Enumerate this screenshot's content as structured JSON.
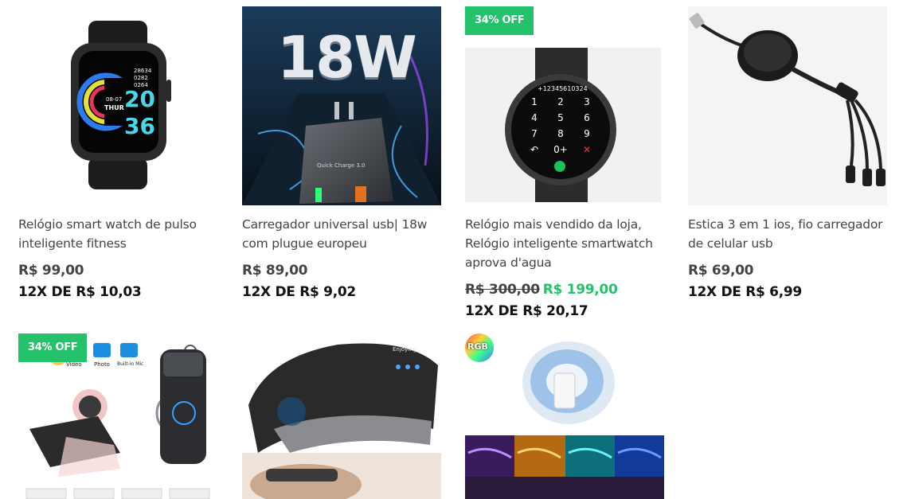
{
  "products": [
    {
      "name": "Relógio smart watch de pulso inteligente fitness",
      "price": "R$ 99,00",
      "installment": "12X DE R$ 10,03",
      "watch_screen": {
        "date": "08-07",
        "day": "THUR",
        "hour": "20",
        "minute": "36",
        "steps": "28634",
        "hr": "0282",
        "kcal": "0264"
      }
    },
    {
      "name": "Carregador universal usb| 18w com plugue europeu",
      "price": "R$ 89,00",
      "installment": "12X DE R$ 9,02",
      "image_text": "18W",
      "plug_text": "Quick Charge 3.0"
    },
    {
      "badge": "34% OFF",
      "name": "Relógio mais vendido da loja, Relógio inteligente smartwatch aprova d'agua",
      "old_price": "R$ 300,00",
      "new_price": "R$ 199,00",
      "installment": "12X DE R$ 20,17",
      "dial_number": "+12345610324",
      "keys": [
        "1",
        "2",
        "3",
        "4",
        "5",
        "6",
        "7",
        "8",
        "9",
        "↶",
        "0+",
        "✕"
      ]
    },
    {
      "name": "Estica 3 em 1 ios, fio carregador de celular usb",
      "price": "R$ 69,00",
      "installment": "12X DE R$ 6,99"
    },
    {
      "badge": "34% OFF",
      "image_labels": [
        "Video",
        "Photo",
        "Built-in Mic"
      ]
    },
    {
      "image_text": "Enjoying"
    },
    {
      "image_badge": "RGB"
    }
  ],
  "colors": {
    "accent_green": "#25c26b",
    "text": "#444444",
    "installment": "#111111"
  }
}
